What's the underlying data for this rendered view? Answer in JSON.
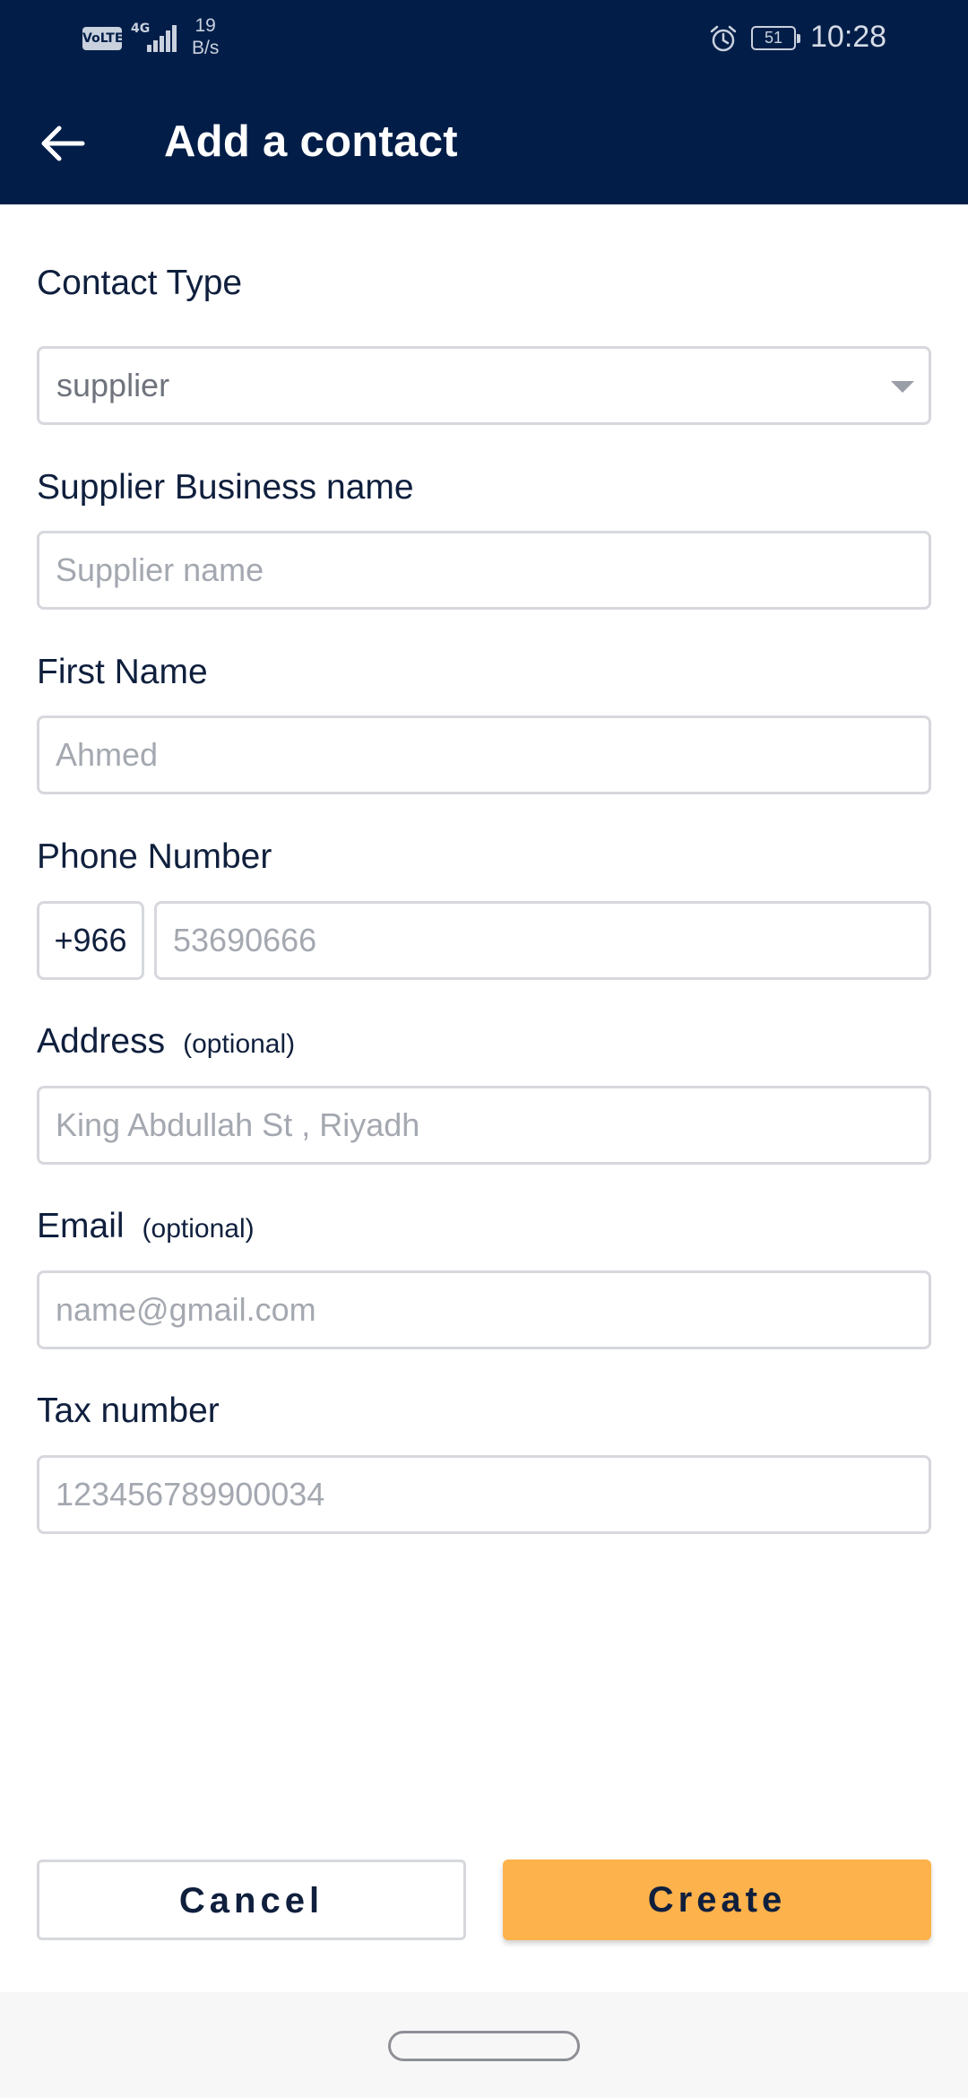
{
  "status_bar": {
    "volte": "VoLTE",
    "network": "4G",
    "speed_value": "19",
    "speed_unit": "B/s",
    "battery": "51",
    "time": "10:28"
  },
  "app_bar": {
    "title": "Add a contact",
    "background": "#021e48"
  },
  "form": {
    "contact_type": {
      "label": "Contact Type",
      "value": "supplier"
    },
    "business_name": {
      "label": "Supplier Business name",
      "placeholder": "Supplier name"
    },
    "first_name": {
      "label": "First Name",
      "placeholder": "Ahmed"
    },
    "phone": {
      "label": "Phone Number",
      "country_code": "+966",
      "placeholder": "53690666"
    },
    "address": {
      "label": "Address",
      "optional": "(optional)",
      "placeholder": "King Abdullah St , Riyadh"
    },
    "email": {
      "label": "Email",
      "optional": "(optional)",
      "placeholder": "name@gmail.com"
    },
    "tax_number": {
      "label": "Tax number",
      "placeholder": "123456789900034"
    }
  },
  "actions": {
    "cancel_label": "Cancel",
    "create_label": "Create",
    "create_color": "#fdb24b"
  }
}
